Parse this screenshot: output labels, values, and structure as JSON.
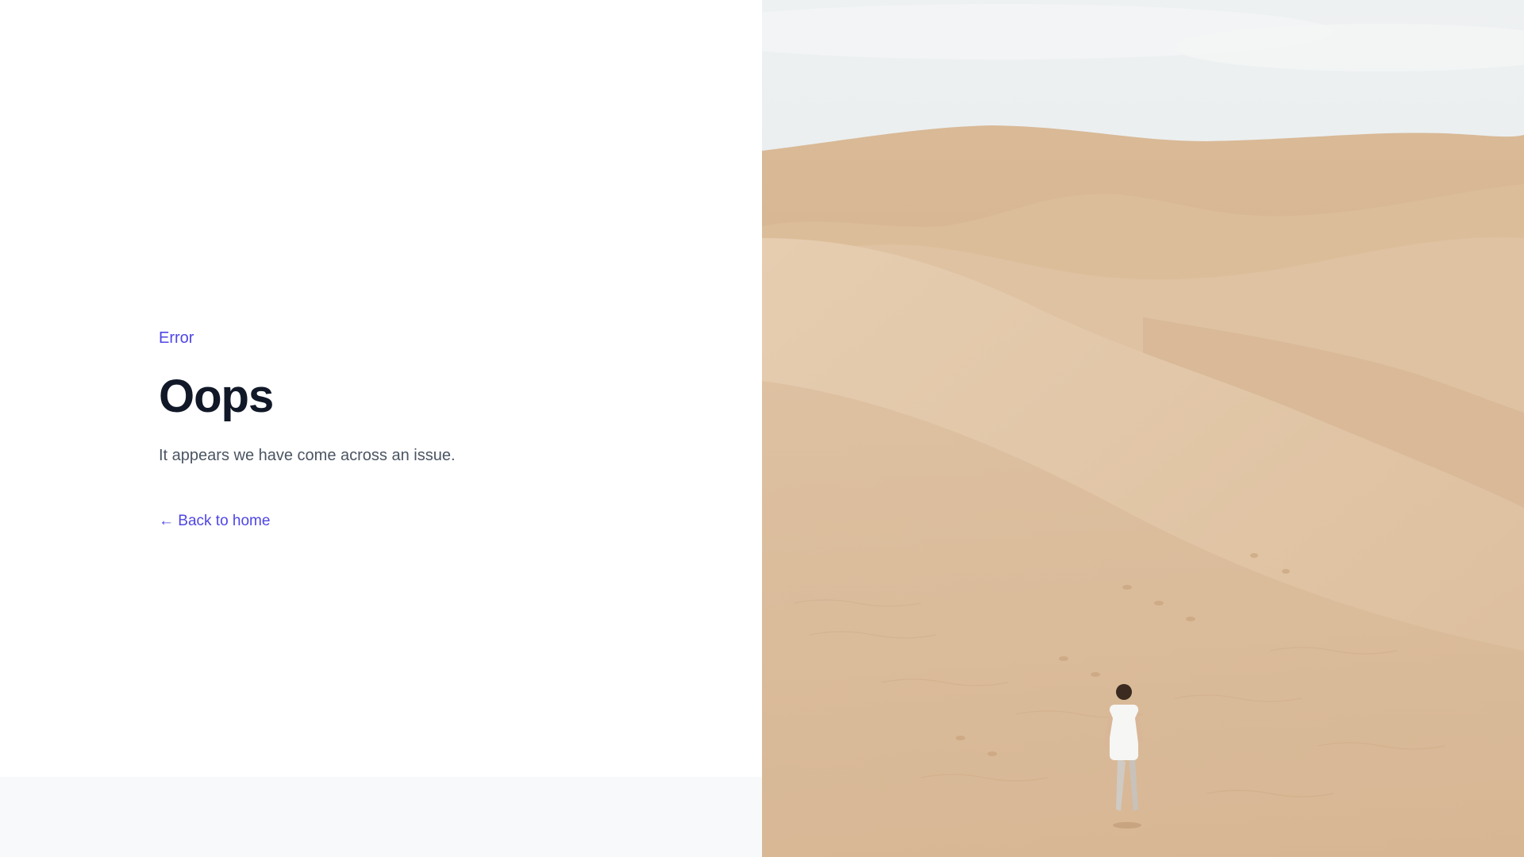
{
  "error_page": {
    "eyebrow": "Error",
    "title": "Oops",
    "message": "It appears we have come across an issue.",
    "back_link_arrow": "←",
    "back_link_label": "Back to home"
  },
  "hero_image": {
    "subject": "person walking on desert sand dunes",
    "colors": {
      "sky": "#e4e8ea",
      "sand_light": "#e3c7a6",
      "sand_mid": "#d8b691",
      "sand_dark": "#c9a37c"
    }
  },
  "theme": {
    "accent": "#4f46e5",
    "heading": "#111827",
    "body_text": "#4b5563",
    "footer_bg": "#f8f9fb"
  }
}
